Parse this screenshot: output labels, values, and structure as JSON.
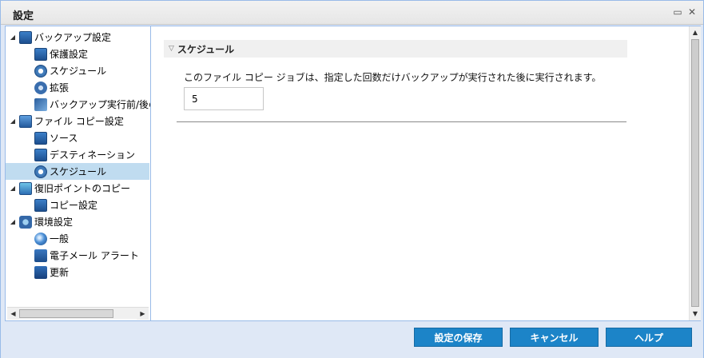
{
  "window": {
    "title": "設定",
    "restore_icon": "restore-icon",
    "close_icon": "close-icon"
  },
  "tree": {
    "items": [
      {
        "label": "バックアップ設定",
        "level": 0,
        "expanded": true,
        "icon": "backup-settings-icon"
      },
      {
        "label": "保護設定",
        "level": 1,
        "icon": "protection-icon"
      },
      {
        "label": "スケジュール",
        "level": 1,
        "icon": "schedule-icon"
      },
      {
        "label": "拡張",
        "level": 1,
        "icon": "advanced-icon"
      },
      {
        "label": "バックアップ実行前/後の",
        "level": 1,
        "icon": "wrench-icon"
      },
      {
        "label": "ファイル コピー設定",
        "level": 0,
        "expanded": true,
        "icon": "file-copy-icon"
      },
      {
        "label": "ソース",
        "level": 1,
        "icon": "source-icon"
      },
      {
        "label": "デスティネーション",
        "level": 1,
        "icon": "destination-icon"
      },
      {
        "label": "スケジュール",
        "level": 1,
        "icon": "schedule-icon",
        "selected": true
      },
      {
        "label": "復旧ポイントのコピー",
        "level": 0,
        "expanded": true,
        "icon": "recovery-point-icon"
      },
      {
        "label": "コピー設定",
        "level": 1,
        "icon": "copy-settings-icon"
      },
      {
        "label": "環境設定",
        "level": 0,
        "expanded": true,
        "icon": "preferences-icon"
      },
      {
        "label": "一般",
        "level": 1,
        "icon": "globe-icon"
      },
      {
        "label": "電子メール アラート",
        "level": 1,
        "icon": "mail-icon"
      },
      {
        "label": "更新",
        "level": 1,
        "icon": "update-icon"
      }
    ]
  },
  "section": {
    "title": "スケジュール",
    "description": "このファイル コピー ジョブは、指定した回数だけバックアップが実行された後に実行されます。",
    "count_value": "5"
  },
  "footer": {
    "save_label": "設定の保存",
    "cancel_label": "キャンセル",
    "help_label": "ヘルプ"
  },
  "colors": {
    "accent": "#1c84c8",
    "selected_row": "#c0dcf0",
    "frame": "#dfe8f6"
  }
}
